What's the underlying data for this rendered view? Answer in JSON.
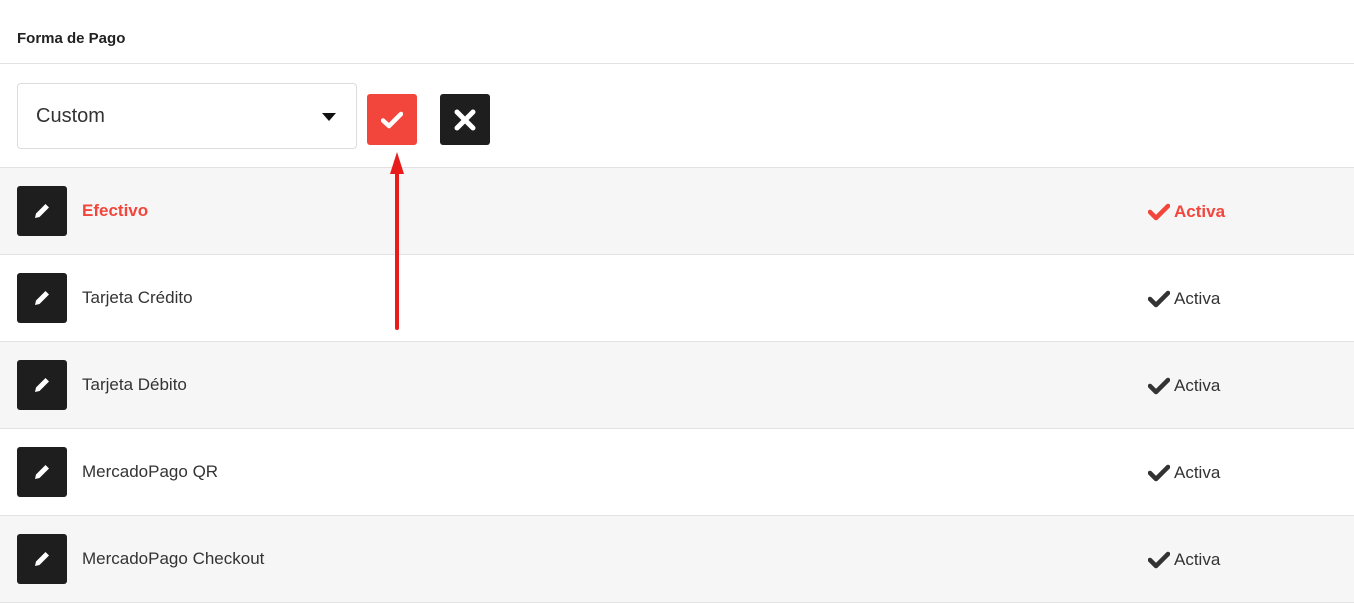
{
  "header": {
    "title": "Forma de Pago"
  },
  "toolbar": {
    "select_value": "Custom",
    "confirm_icon": "check-icon",
    "cancel_icon": "close-icon"
  },
  "colors": {
    "accent": "#f2463c",
    "dark": "#1e1e1e",
    "annotation": "#e81c1c"
  },
  "payment_methods": [
    {
      "name": "Efectivo",
      "status": "Activa",
      "selected": true
    },
    {
      "name": "Tarjeta Crédito",
      "status": "Activa",
      "selected": false
    },
    {
      "name": "Tarjeta Débito",
      "status": "Activa",
      "selected": false
    },
    {
      "name": "MercadoPago QR",
      "status": "Activa",
      "selected": false
    },
    {
      "name": "MercadoPago Checkout",
      "status": "Activa",
      "selected": false
    }
  ]
}
